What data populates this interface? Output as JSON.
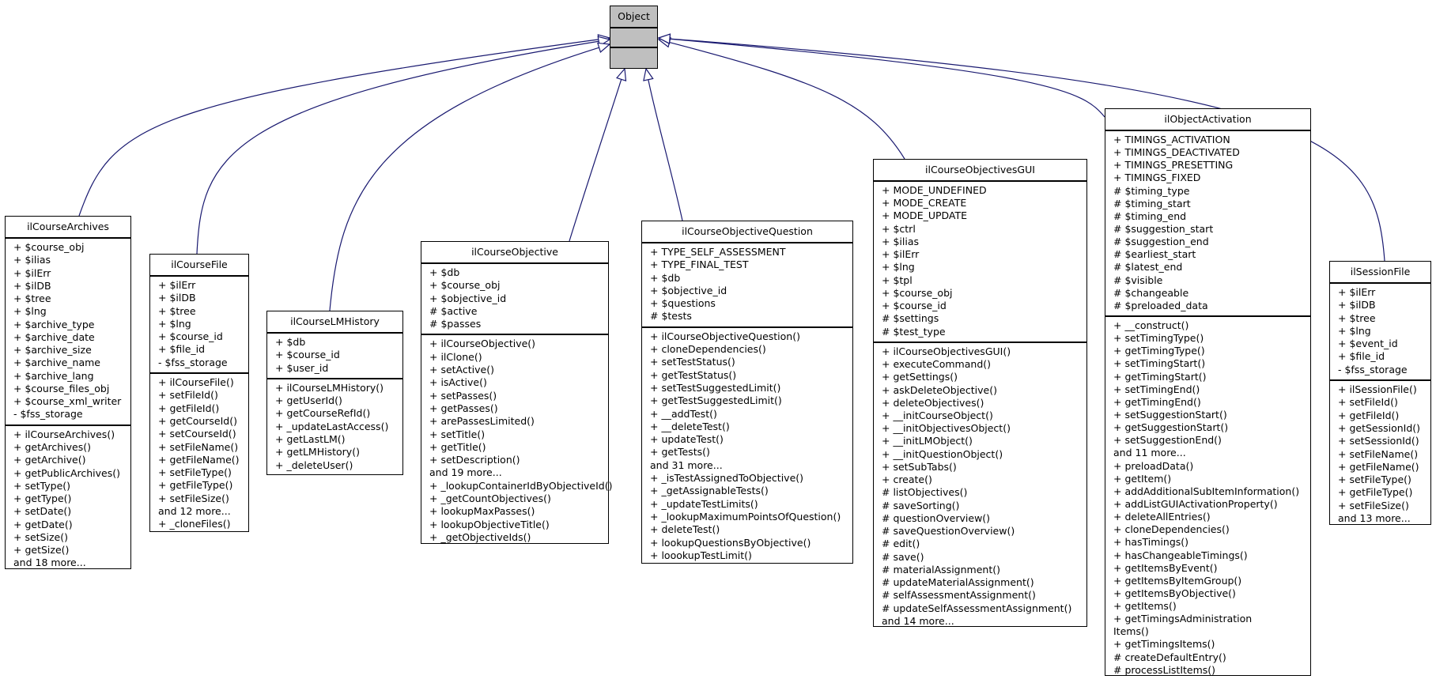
{
  "colors": {
    "edge": "#191970",
    "base_fill": "#bfbfbf",
    "box_fill": "#ffffff"
  },
  "base_class": {
    "name": "Object",
    "attributes": [],
    "methods": []
  },
  "classes": [
    {
      "name": "ilCourseArchives",
      "attributes": [
        "+ $course_obj",
        "+ $ilias",
        "+ $ilErr",
        "+ $ilDB",
        "+ $tree",
        "+ $lng",
        "+ $archive_type",
        "+ $archive_date",
        "+ $archive_size",
        "+ $archive_name",
        "+ $archive_lang",
        "+ $course_files_obj",
        "+ $course_xml_writer",
        "- $fss_storage"
      ],
      "methods": [
        "+ ilCourseArchives()",
        "+ getArchives()",
        "+ getArchive()",
        "+ getPublicArchives()",
        "+ setType()",
        "+ getType()",
        "+ setDate()",
        "+ getDate()",
        "+ setSize()",
        "+ getSize()",
        "and 18 more..."
      ]
    },
    {
      "name": "ilCourseFile",
      "attributes": [
        "+ $ilErr",
        "+ $ilDB",
        "+ $tree",
        "+ $lng",
        "+ $course_id",
        "+ $file_id",
        "- $fss_storage"
      ],
      "methods": [
        "+ ilCourseFile()",
        "+ setFileId()",
        "+ getFileId()",
        "+ getCourseId()",
        "+ setCourseId()",
        "+ setFileName()",
        "+ getFileName()",
        "+ setFileType()",
        "+ getFileType()",
        "+ setFileSize()",
        "and 12 more...",
        "+ _cloneFiles()"
      ]
    },
    {
      "name": "ilCourseLMHistory",
      "attributes": [
        "+ $db",
        "+ $course_id",
        "+ $user_id"
      ],
      "methods": [
        "+ ilCourseLMHistory()",
        "+ getUserId()",
        "+ getCourseRefId()",
        "+ _updateLastAccess()",
        "+ getLastLM()",
        "+ getLMHistory()",
        "+ _deleteUser()"
      ]
    },
    {
      "name": "ilCourseObjective",
      "attributes": [
        "+ $db",
        "+ $course_obj",
        "+ $objective_id",
        "# $active",
        "# $passes"
      ],
      "methods": [
        "+ ilCourseObjective()",
        "+ ilClone()",
        "+ setActive()",
        "+ isActive()",
        "+ setPasses()",
        "+ getPasses()",
        "+ arePassesLimited()",
        "+ setTitle()",
        "+ getTitle()",
        "+ setDescription()",
        "and 19 more...",
        "+ _lookupContainerIdByObjectiveId()",
        "+ _getCountObjectives()",
        "+ lookupMaxPasses()",
        "+ lookupObjectiveTitle()",
        "+ _getObjectiveIds()"
      ]
    },
    {
      "name": "ilCourseObjectiveQuestion",
      "attributes": [
        "+ TYPE_SELF_ASSESSMENT",
        "+ TYPE_FINAL_TEST",
        "+ $db",
        "+ $objective_id",
        "+ $questions",
        "# $tests"
      ],
      "methods": [
        "+ ilCourseObjectiveQuestion()",
        "+ cloneDependencies()",
        "+ setTestStatus()",
        "+ getTestStatus()",
        "+ setTestSuggestedLimit()",
        "+ getTestSuggestedLimit()",
        "+ __addTest()",
        "+ __deleteTest()",
        "+ updateTest()",
        "+ getTests()",
        "and 31 more...",
        "+ _isTestAssignedToObjective()",
        "+ _getAssignableTests()",
        "+ _updateTestLimits()",
        "+ _lookupMaximumPointsOfQuestion()",
        "+ deleteTest()",
        "+ lookupQuestionsByObjective()",
        "+ loookupTestLimit()"
      ]
    },
    {
      "name": "ilCourseObjectivesGUI",
      "attributes": [
        "+ MODE_UNDEFINED",
        "+ MODE_CREATE",
        "+ MODE_UPDATE",
        "+ $ctrl",
        "+ $ilias",
        "+ $ilErr",
        "+ $lng",
        "+ $tpl",
        "+ $course_obj",
        "+ $course_id",
        "# $settings",
        "# $test_type"
      ],
      "methods": [
        "+ ilCourseObjectivesGUI()",
        "+ executeCommand()",
        "+ getSettings()",
        "+ askDeleteObjective()",
        "+ deleteObjectives()",
        "+ __initCourseObject()",
        "+ __initObjectivesObject()",
        "+ __initLMObject()",
        "+ __initQuestionObject()",
        "+ setSubTabs()",
        "+ create()",
        "# listObjectives()",
        "# saveSorting()",
        "# questionOverview()",
        "# saveQuestionOverview()",
        "# edit()",
        "# save()",
        "# materialAssignment()",
        "# updateMaterialAssignment()",
        "# selfAssessmentAssignment()",
        "# updateSelfAssessmentAssignment()",
        "and 14 more..."
      ]
    },
    {
      "name": "ilObjectActivation",
      "attributes": [
        "+ TIMINGS_ACTIVATION",
        "+ TIMINGS_DEACTIVATED",
        "+ TIMINGS_PRESETTING",
        "+ TIMINGS_FIXED",
        "# $timing_type",
        "# $timing_start",
        "# $timing_end",
        "# $suggestion_start",
        "# $suggestion_end",
        "# $earliest_start",
        "# $latest_end",
        "# $visible",
        "# $changeable",
        "# $preloaded_data"
      ],
      "methods": [
        "+ __construct()",
        "+ setTimingType()",
        "+ getTimingType()",
        "+ setTimingStart()",
        "+ getTimingStart()",
        "+ setTimingEnd()",
        "+ getTimingEnd()",
        "+ setSuggestionStart()",
        "+ getSuggestionStart()",
        "+ setSuggestionEnd()",
        "and 11 more...",
        "+ preloadData()",
        "+ getItem()",
        "+ addAdditionalSubItemInformation()",
        "+ addListGUIActivationProperty()",
        "+ deleteAllEntries()",
        "+ cloneDependencies()",
        "+ hasTimings()",
        "+ hasChangeableTimings()",
        "+ getItemsByEvent()",
        "+ getItemsByItemGroup()",
        "+ getItemsByObjective()",
        "+ getItems()",
        "+ getTimingsAdministration",
        "Items()",
        "+ getTimingsItems()",
        "# createDefaultEntry()",
        "# processListItems()"
      ]
    },
    {
      "name": "ilSessionFile",
      "attributes": [
        "+ $ilErr",
        "+ $ilDB",
        "+ $tree",
        "+ $lng",
        "+ $event_id",
        "+ $file_id",
        "- $fss_storage"
      ],
      "methods": [
        "+ ilSessionFile()",
        "+ setFileId()",
        "+ getFileId()",
        "+ getSessionId()",
        "+ setSessionId()",
        "+ setFileName()",
        "+ getFileName()",
        "+ setFileType()",
        "+ getFileType()",
        "+ setFileSize()",
        "and 13 more..."
      ]
    }
  ]
}
